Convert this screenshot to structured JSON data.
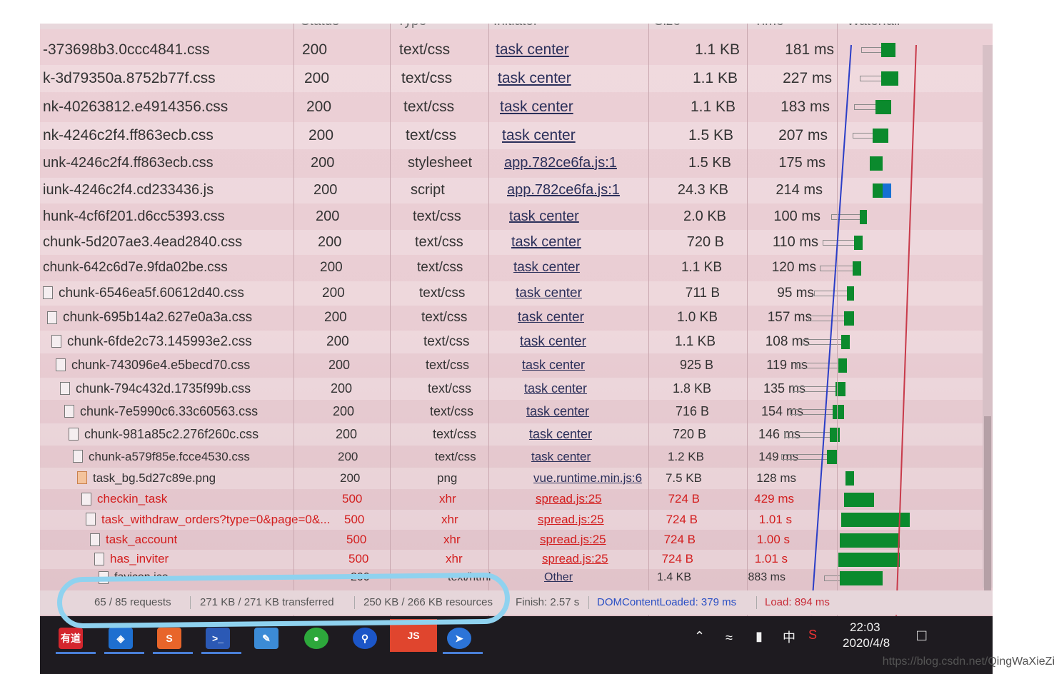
{
  "header": {
    "status": "Status",
    "type": "Type",
    "initiator": "Initiator",
    "size": "Size",
    "time": "Time",
    "waterfall": "Waterfall"
  },
  "rows": [
    {
      "name": "-373698b3.0ccc4841.css",
      "status": "200",
      "type": "text/css",
      "initiator": "task center",
      "size": "1.1 KB",
      "time": "181 ms"
    },
    {
      "name": "k-3d79350a.8752b77f.css",
      "status": "200",
      "type": "text/css",
      "initiator": "task center",
      "size": "1.1 KB",
      "time": "227 ms"
    },
    {
      "name": "nk-40263812.e4914356.css",
      "status": "200",
      "type": "text/css",
      "initiator": "task center",
      "size": "1.1 KB",
      "time": "183 ms"
    },
    {
      "name": "nk-4246c2f4.ff863ecb.css",
      "status": "200",
      "type": "text/css",
      "initiator": "task center",
      "size": "1.5 KB",
      "time": "207 ms"
    },
    {
      "name": "unk-4246c2f4.ff863ecb.css",
      "status": "200",
      "type": "stylesheet",
      "initiator": "app.782ce6fa.js:1",
      "size": "1.5 KB",
      "time": "175 ms"
    },
    {
      "name": "iunk-4246c2f4.cd233436.js",
      "status": "200",
      "type": "script",
      "initiator": "app.782ce6fa.js:1",
      "size": "24.3 KB",
      "time": "214 ms"
    },
    {
      "name": "hunk-4cf6f201.d6cc5393.css",
      "status": "200",
      "type": "text/css",
      "initiator": "task center",
      "size": "2.0 KB",
      "time": "100 ms"
    },
    {
      "name": "chunk-5d207ae3.4ead2840.css",
      "status": "200",
      "type": "text/css",
      "initiator": "task center",
      "size": "720 B",
      "time": "110 ms"
    },
    {
      "name": "chunk-642c6d7e.9fda02be.css",
      "status": "200",
      "type": "text/css",
      "initiator": "task center",
      "size": "1.1 KB",
      "time": "120 ms"
    },
    {
      "name": "chunk-6546ea5f.60612d40.css",
      "status": "200",
      "type": "text/css",
      "initiator": "task center",
      "size": "711 B",
      "time": "95 ms"
    },
    {
      "name": "chunk-695b14a2.627e0a3a.css",
      "status": "200",
      "type": "text/css",
      "initiator": "task center",
      "size": "1.0 KB",
      "time": "157 ms"
    },
    {
      "name": "chunk-6fde2c73.145993e2.css",
      "status": "200",
      "type": "text/css",
      "initiator": "task center",
      "size": "1.1 KB",
      "time": "108 ms"
    },
    {
      "name": "chunk-743096e4.e5becd70.css",
      "status": "200",
      "type": "text/css",
      "initiator": "task center",
      "size": "925 B",
      "time": "119 ms"
    },
    {
      "name": "chunk-794c432d.1735f99b.css",
      "status": "200",
      "type": "text/css",
      "initiator": "task center",
      "size": "1.8 KB",
      "time": "135 ms"
    },
    {
      "name": "chunk-7e5990c6.33c60563.css",
      "status": "200",
      "type": "text/css",
      "initiator": "task center",
      "size": "716 B",
      "time": "154 ms"
    },
    {
      "name": "chunk-981a85c2.276f260c.css",
      "status": "200",
      "type": "text/css",
      "initiator": "task center",
      "size": "720 B",
      "time": "146 ms"
    },
    {
      "name": "chunk-a579f85e.fcce4530.css",
      "status": "200",
      "type": "text/css",
      "initiator": "task center",
      "size": "1.2 KB",
      "time": "149 ms"
    },
    {
      "name": "task_bg.5d27c89e.png",
      "status": "200",
      "type": "png",
      "initiator": "vue.runtime.min.js:6",
      "size": "7.5 KB",
      "time": "128 ms"
    },
    {
      "name": "checkin_task",
      "status": "500",
      "type": "xhr",
      "initiator": "spread.js:25",
      "size": "724 B",
      "time": "429 ms"
    },
    {
      "name": "task_withdraw_orders?type=0&page=0&...",
      "status": "500",
      "type": "xhr",
      "initiator": "spread.js:25",
      "size": "724 B",
      "time": "1.01 s"
    },
    {
      "name": "task_account",
      "status": "500",
      "type": "xhr",
      "initiator": "spread.js:25",
      "size": "724 B",
      "time": "1.00 s"
    },
    {
      "name": "has_inviter",
      "status": "500",
      "type": "xhr",
      "initiator": "spread.js:25",
      "size": "724 B",
      "time": "1.01 s"
    },
    {
      "name": "favicon.ico",
      "status": "200",
      "type": "text/html",
      "initiator": "Other",
      "size": "1.4 KB",
      "time": "883 ms"
    }
  ],
  "status_bar": {
    "requests": "65 / 85 requests",
    "transferred": "271 KB / 271 KB transferred",
    "resources": "250 KB / 266 KB resources",
    "finish": "Finish: 2.57 s",
    "dom_content_loaded": "DOMContentLoaded: 379 ms",
    "load": "Load: 894 ms"
  },
  "taskbar": {
    "apps": [
      "youdao-app",
      "vscode-app",
      "sublime-app",
      "powershell-app",
      "notepad-app",
      "wechat-app",
      "maps-app",
      "nodejs-app",
      "feishu-app"
    ],
    "youdao_label": "有道",
    "ime": "中",
    "clock_time": "22:03",
    "clock_date": "2020/4/8"
  },
  "watermark": "https://blog.csdn.net/QingWaXieZi",
  "colors": {
    "error": "#d31d1d",
    "waterfall_green": "#0b8a2d",
    "dom_line": "#2b3ec7",
    "load_line": "#c83a4a",
    "highlight": "#8fd2ef"
  }
}
